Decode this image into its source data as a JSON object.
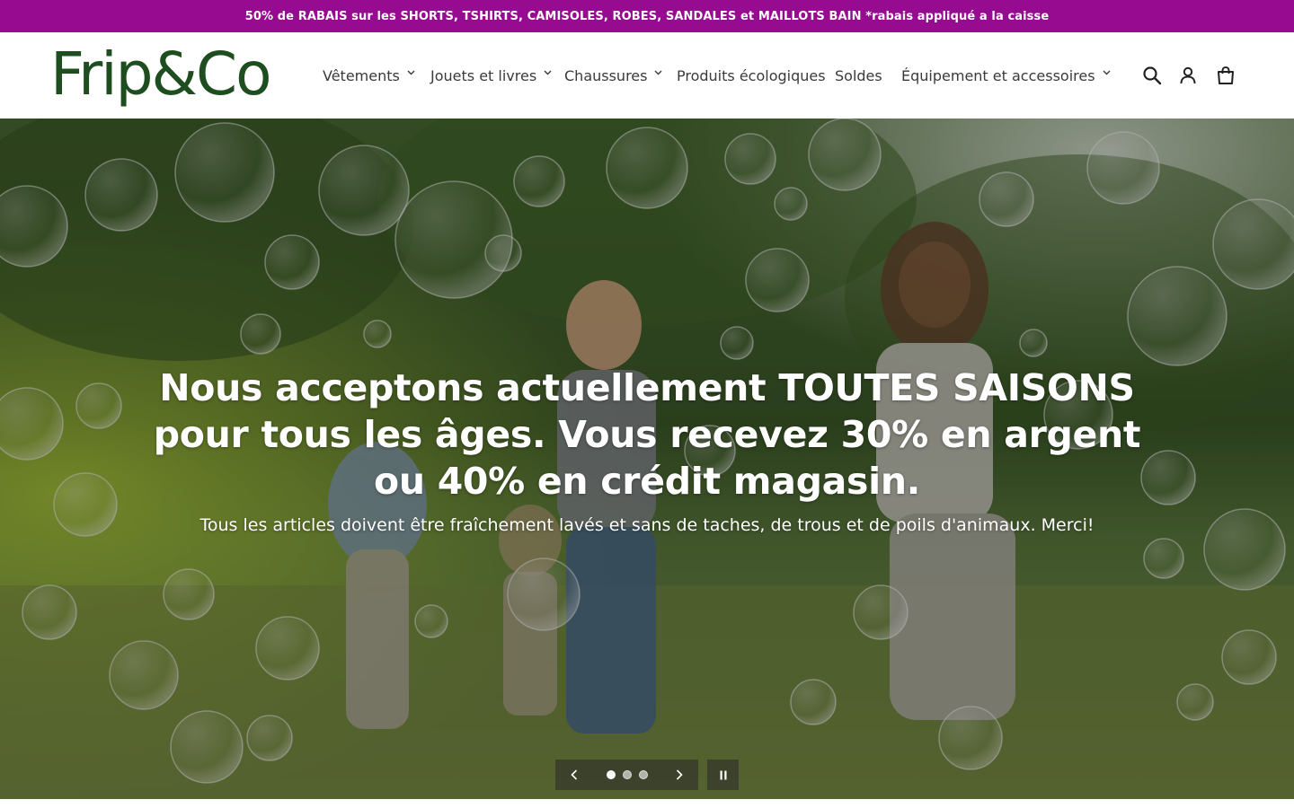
{
  "announcement": {
    "text": "50% de RABAIS sur les SHORTS, TSHIRTS, CAMISOLES, ROBES, SANDALES et MAILLOTS BAIN *rabais appliqué a la caisse"
  },
  "header": {
    "logo_text": "Frip&Co",
    "nav": [
      {
        "label": "Vêtements",
        "has_dropdown": true
      },
      {
        "label": "Jouets et livres",
        "has_dropdown": true
      },
      {
        "label": "Chaussures",
        "has_dropdown": true
      },
      {
        "label": "Produits écologiques",
        "has_dropdown": false
      },
      {
        "label": "Soldes",
        "has_dropdown": false
      },
      {
        "label": "Équipement et accessoires",
        "has_dropdown": true
      }
    ],
    "icons": [
      "search-icon",
      "account-icon",
      "cart-icon"
    ]
  },
  "hero": {
    "title": "Nous acceptons actuellement TOUTES SAISONS pour tous les âges. Vous recevez 30% en argent ou 40% en crédit magasin.",
    "subtitle": "Tous les articles doivent être fraîchement lavés et sans de taches, de trous et de poils d'animaux. Merci!",
    "slides_total": 3,
    "active_slide": 1
  },
  "colors": {
    "announcement_bg": "#960b8f",
    "logo": "#1e4d1f",
    "nav_text": "#3a3a3a"
  }
}
